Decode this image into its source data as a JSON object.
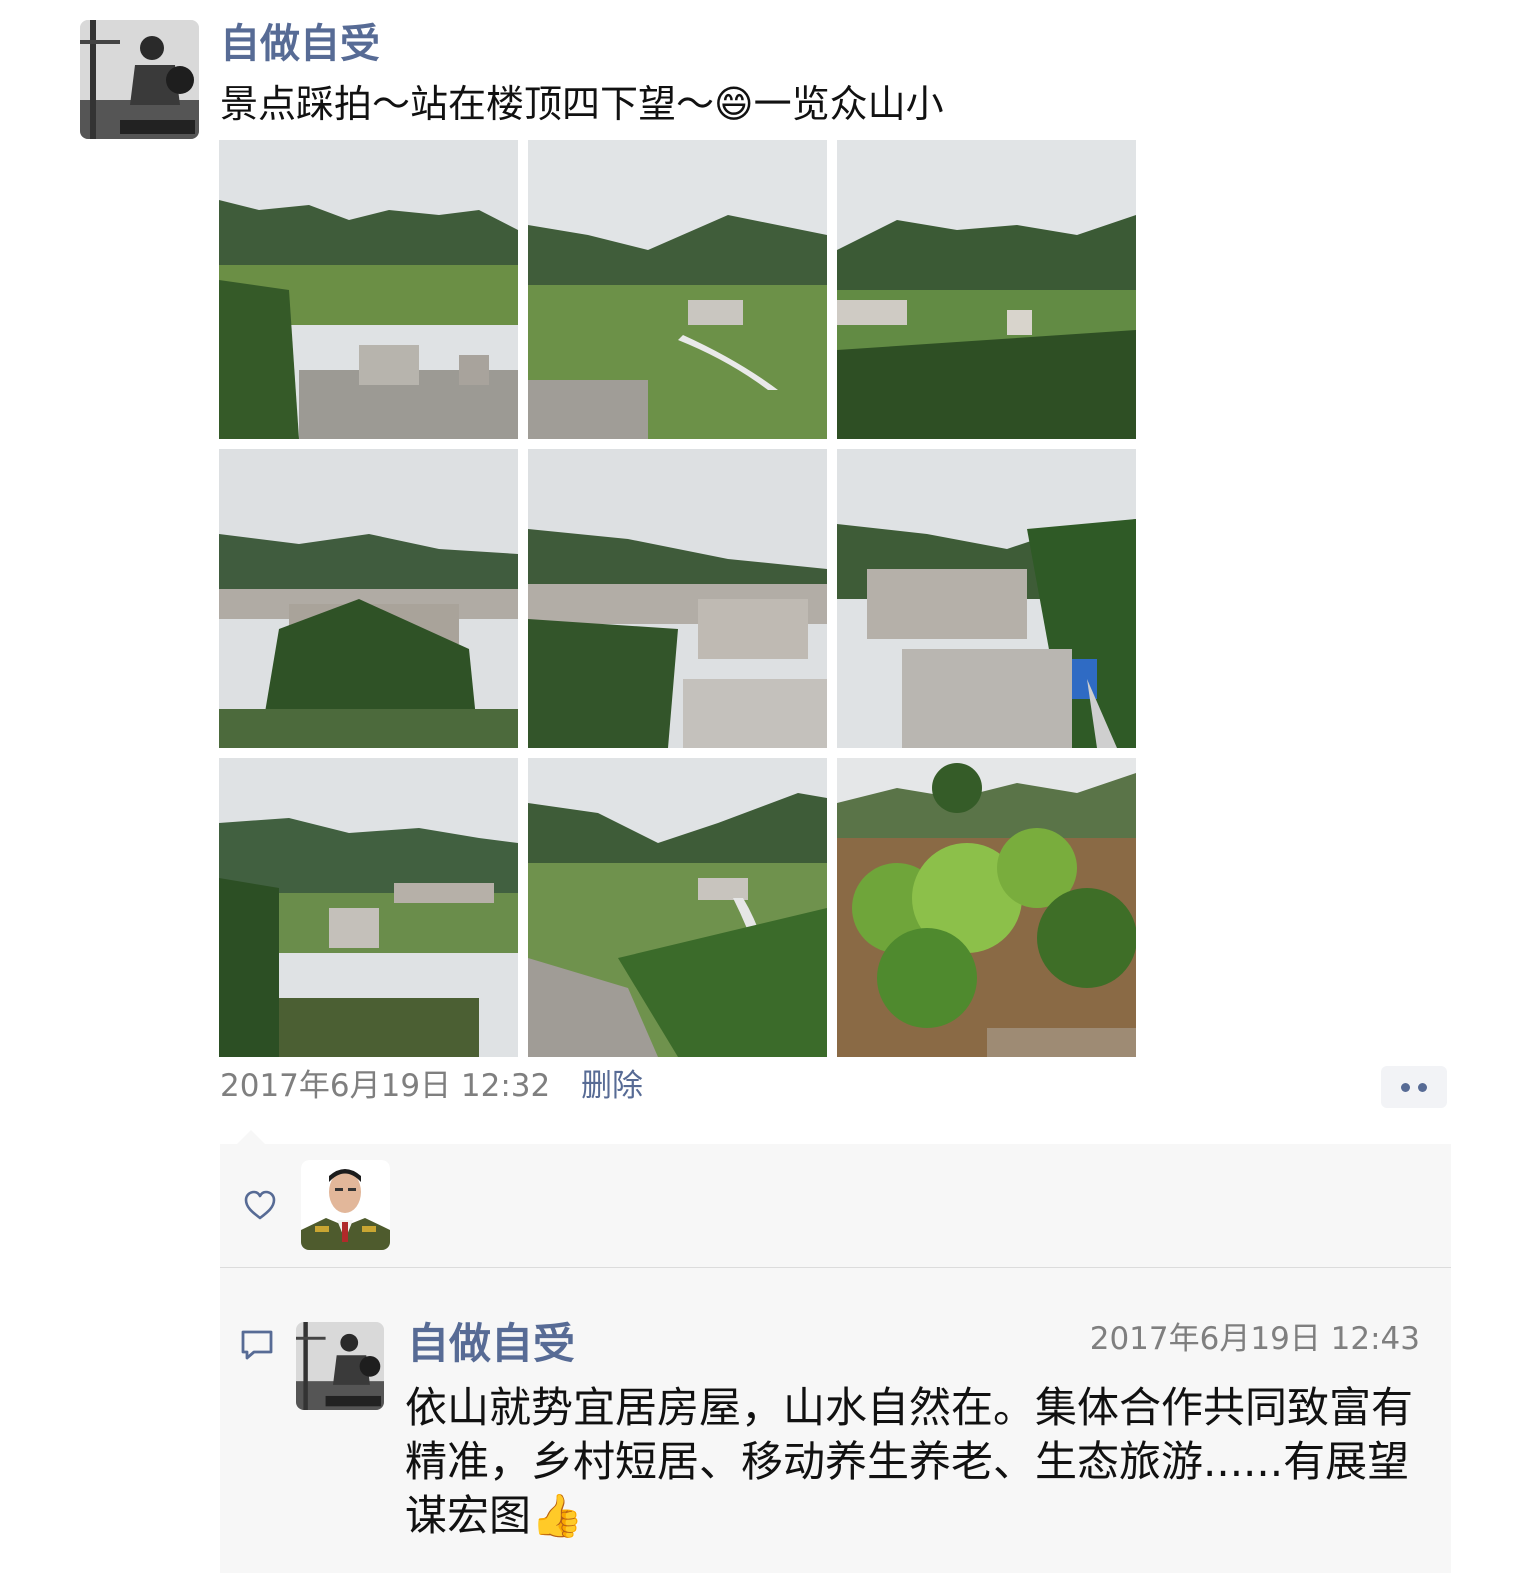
{
  "post": {
    "author": "自做自受",
    "text": "景点踩拍～站在楼顶四下望～😄一览众山小",
    "photos": [
      {
        "name": "photo-1",
        "scene": "mountains-rooftop"
      },
      {
        "name": "photo-2",
        "scene": "valley-village"
      },
      {
        "name": "photo-3",
        "scene": "valley-green"
      },
      {
        "name": "photo-4",
        "scene": "village-trees"
      },
      {
        "name": "photo-5",
        "scene": "village-rooftop"
      },
      {
        "name": "photo-6",
        "scene": "village-road"
      },
      {
        "name": "photo-7",
        "scene": "terraces"
      },
      {
        "name": "photo-8",
        "scene": "valley-fields"
      },
      {
        "name": "photo-9",
        "scene": "bamboo"
      }
    ],
    "timestamp": "2017年6月19日 12:32",
    "delete_label": "删除"
  },
  "likes": {
    "icon": "heart-icon"
  },
  "comment": {
    "icon": "comment-icon",
    "author": "自做自受",
    "timestamp": "2017年6月19日 12:43",
    "text": "依山就势宜居房屋，山水自然在。集体合作共同致富有精准，乡村短居、移动养生养老、生态旅游......有展望谋宏图👍"
  },
  "colors": {
    "link": "#576b95",
    "meta": "#7f7f7f",
    "panel": "#f7f7f7"
  }
}
